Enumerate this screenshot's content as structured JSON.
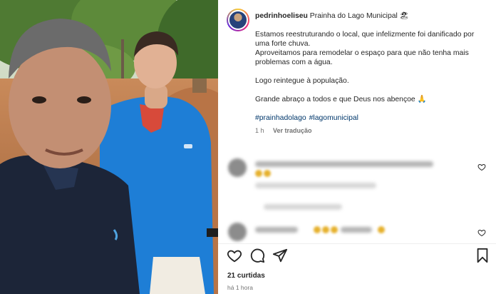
{
  "post": {
    "username": "pedrinhoeliseu",
    "title": "Prainha do Lago Municipal 🏖",
    "caption_lines": [
      "Estamos reestruturando o local, que infelizmente foi danificado por uma forte chuva.",
      "Aproveitamos para remodelar o espaço para que não tenha mais problemas com a água.",
      "Logo reintegue à população.",
      "Grande abraço a todos e que Deus nos abençoe 🙏"
    ],
    "hashtags": [
      "#prainhadolago",
      "#lagomunicipal"
    ],
    "posted_ago": "1 h",
    "translate_label": "Ver tradução",
    "likes": "21 curtidas",
    "timestamp": "há 1 hora"
  },
  "icons": {
    "like": "heart-icon",
    "comment": "comment-icon",
    "share": "share-icon",
    "save": "bookmark-icon"
  },
  "colors": {
    "text": "#262626",
    "muted": "#737373",
    "hashtag": "#00376b"
  }
}
